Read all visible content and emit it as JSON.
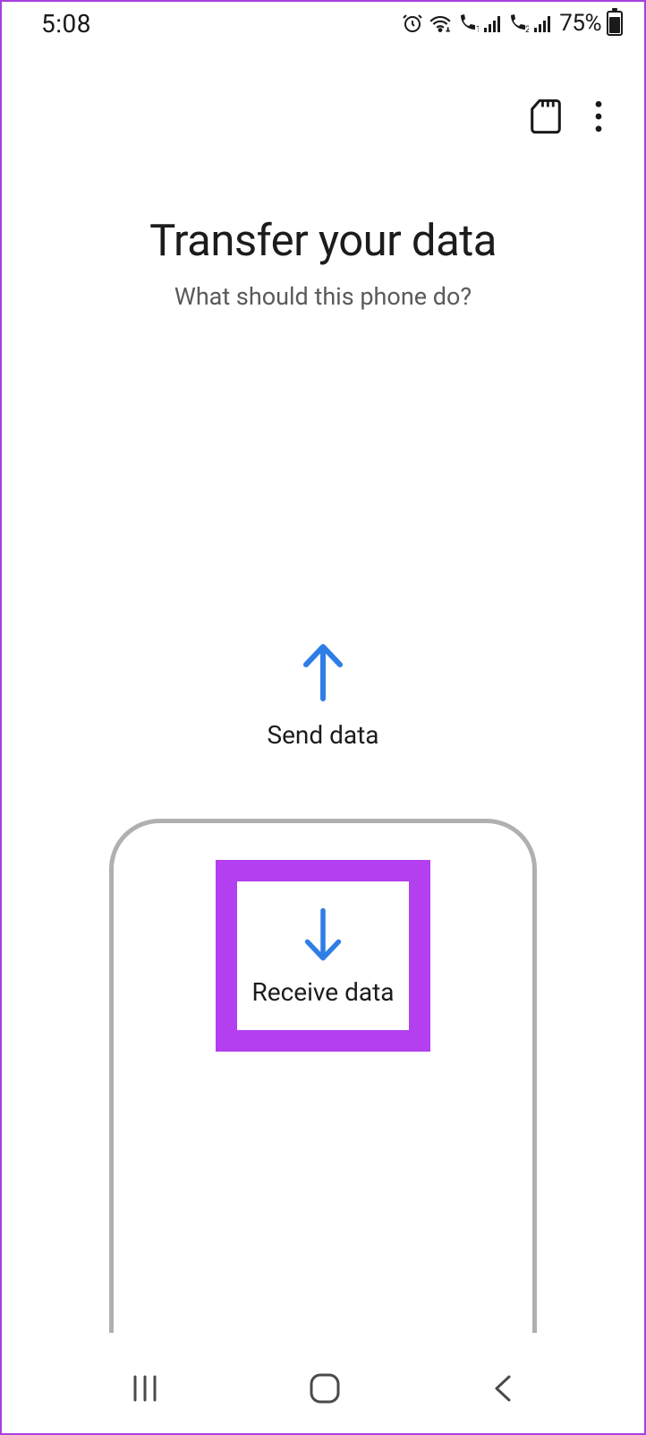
{
  "status": {
    "time": "5:08",
    "battery_percent": "75%"
  },
  "header": {
    "title": "Transfer your data",
    "subtitle": "What should this phone do?"
  },
  "actions": {
    "send_label": "Send data",
    "receive_label": "Receive data"
  },
  "colors": {
    "accent": "#2f7ee6",
    "highlight": "#b33ff0"
  }
}
